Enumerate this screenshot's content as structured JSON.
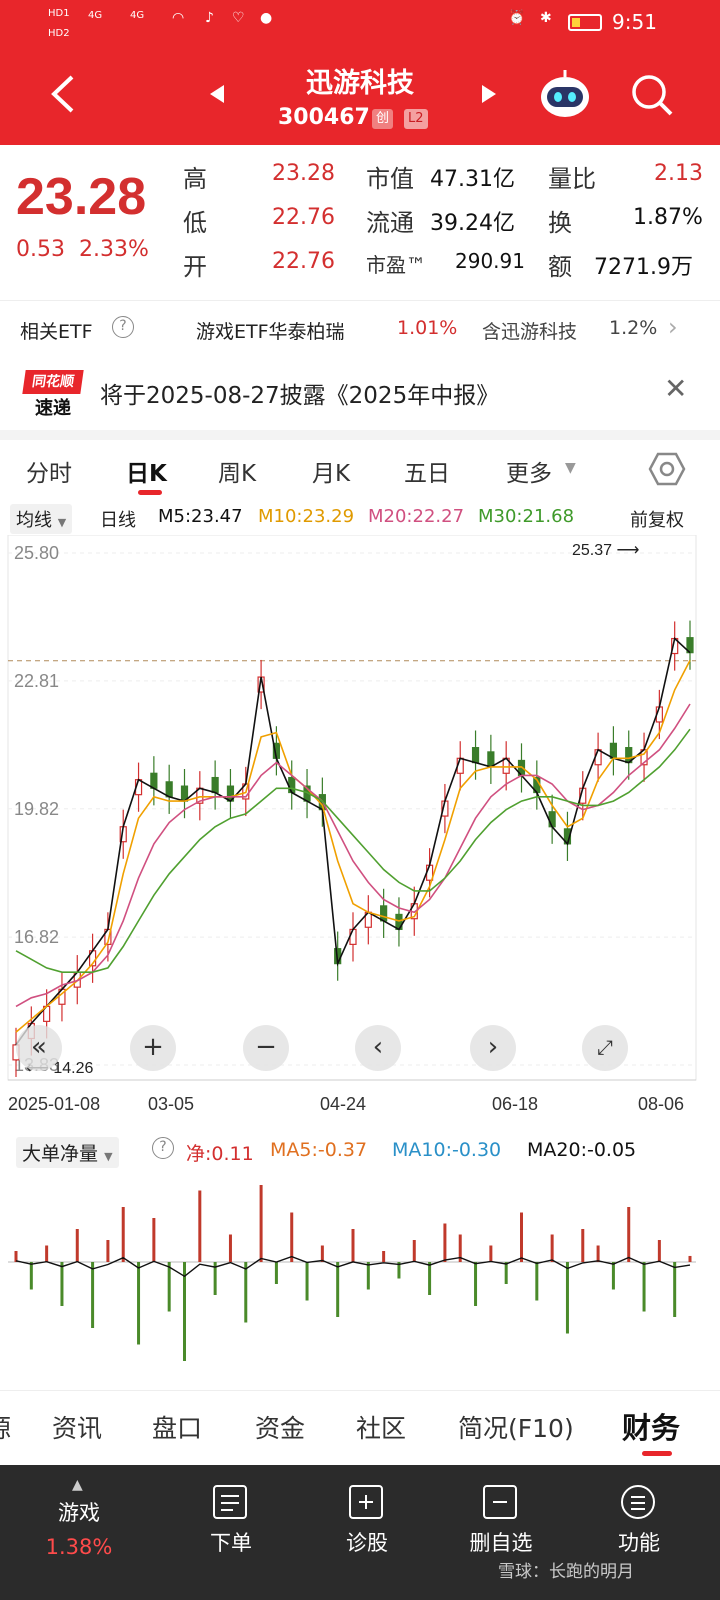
{
  "status_bar": {
    "left": [
      "HD1",
      "HD2",
      "4G",
      "4G"
    ],
    "time": "9:51"
  },
  "header": {
    "title": "迅游科技",
    "code": "300467",
    "tag_chuang": "创",
    "tag_level": "L2"
  },
  "quote": {
    "price": "23.28",
    "change": "0.53",
    "change_pct": "2.33%",
    "high_label": "高",
    "high": "23.28",
    "low_label": "低",
    "low": "22.76",
    "open_label": "开",
    "open": "22.76",
    "mktcap_label": "市值",
    "mktcap": "47.31亿",
    "float_label": "流通",
    "float": "39.24亿",
    "pe_label": "市盈™",
    "pe": "290.91",
    "volratio_label": "量比",
    "volratio": "2.13",
    "turnover_label": "换",
    "turnover": "1.87%",
    "amount_label": "额",
    "amount": "7271.9万"
  },
  "etf": {
    "label": "相关ETF",
    "name": "游戏ETF华泰柏瑞",
    "pct": "1.01%",
    "contains": "含迅游科技",
    "contains_pct": "1.2%"
  },
  "notice": {
    "logo_top": "同花顺",
    "logo_bottom": "速递",
    "text": "将于2025-08-27披露《2025年中报》"
  },
  "ktabs": [
    "分时",
    "日K",
    "周K",
    "月K",
    "五日",
    "更多"
  ],
  "ma_line": {
    "selector": "均线",
    "period": "日线",
    "m5": "M5:23.47",
    "m10": "M10:23.29",
    "m20": "M20:22.27",
    "m30": "M30:21.68",
    "adjust": "前复权"
  },
  "chart_data": {
    "type": "line",
    "x": [
      "2025-01-08",
      "03-05",
      "04-24",
      "06-18",
      "08-06"
    ],
    "ylim": [
      13.83,
      25.8
    ],
    "y_ticks": [
      "25.80",
      "22.81",
      "19.82",
      "16.82",
      "13.83"
    ],
    "max_label": "25.37",
    "min_label": "14.26",
    "series": [
      {
        "name": "M5",
        "color": "#111111",
        "values": [
          14.3,
          14.8,
          15.2,
          15.6,
          16.0,
          16.5,
          17.0,
          19.4,
          20.5,
          20.3,
          20.1,
          20.0,
          20.3,
          20.2,
          20.0,
          20.4,
          22.9,
          21.0,
          20.2,
          20.0,
          19.8,
          16.2,
          17.0,
          17.4,
          17.2,
          17.0,
          17.6,
          18.5,
          20.0,
          21.0,
          20.9,
          20.8,
          21.0,
          20.6,
          20.2,
          19.4,
          19.0,
          20.3,
          21.2,
          21.0,
          20.9,
          21.2,
          22.2,
          23.8,
          23.47
        ]
      },
      {
        "name": "M10",
        "color": "#f0a000",
        "values": [
          14.6,
          14.9,
          15.2,
          15.5,
          15.8,
          16.2,
          16.7,
          18.3,
          19.6,
          20.1,
          20.0,
          20.0,
          20.1,
          20.1,
          20.1,
          20.2,
          21.5,
          21.6,
          20.6,
          20.3,
          19.9,
          18.6,
          17.6,
          17.4,
          17.3,
          17.2,
          17.3,
          18.0,
          19.1,
          20.3,
          20.7,
          20.8,
          20.8,
          20.8,
          20.5,
          19.9,
          19.4,
          19.6,
          20.5,
          21.0,
          21.0,
          21.1,
          21.6,
          22.6,
          23.29
        ]
      },
      {
        "name": "M20",
        "color": "#d05080",
        "values": [
          15.2,
          15.4,
          15.5,
          15.7,
          15.8,
          16.0,
          16.4,
          17.2,
          18.2,
          19.0,
          19.5,
          19.8,
          20.0,
          20.1,
          20.1,
          20.1,
          20.6,
          20.9,
          20.6,
          20.3,
          20.0,
          19.3,
          18.6,
          18.1,
          17.7,
          17.5,
          17.4,
          17.7,
          18.2,
          18.9,
          19.6,
          20.1,
          20.4,
          20.6,
          20.6,
          20.4,
          20.0,
          19.8,
          19.9,
          20.2,
          20.6,
          20.9,
          21.2,
          21.7,
          22.27
        ]
      },
      {
        "name": "M30",
        "color": "#50a030",
        "values": [
          16.5,
          16.3,
          16.1,
          16.0,
          16.0,
          16.0,
          16.1,
          16.6,
          17.2,
          17.8,
          18.3,
          18.7,
          19.1,
          19.4,
          19.6,
          19.7,
          20.0,
          20.3,
          20.3,
          20.2,
          20.0,
          19.6,
          19.2,
          18.8,
          18.4,
          18.1,
          17.9,
          17.9,
          18.2,
          18.6,
          19.1,
          19.5,
          19.8,
          20.0,
          20.1,
          20.1,
          20.0,
          19.9,
          19.9,
          20.0,
          20.2,
          20.5,
          20.8,
          21.2,
          21.68
        ]
      }
    ]
  },
  "sub_indicator": {
    "selector": "大单净量",
    "net": "净:0.11",
    "ma5": "MA5:-0.37",
    "ma10": "MA10:-0.30",
    "ma20": "MA20:-0.05"
  },
  "sub_chart_data": {
    "type": "bar",
    "values": [
      0.2,
      -0.5,
      0.3,
      -0.8,
      0.6,
      -1.2,
      0.4,
      1.0,
      -1.5,
      0.8,
      -0.9,
      -1.8,
      1.3,
      -0.6,
      0.5,
      -1.1,
      1.4,
      -0.4,
      0.9,
      -0.7,
      0.3,
      -1.0,
      0.6,
      -0.5,
      0.2,
      -0.3,
      0.4,
      -0.6,
      0.7,
      0.5,
      -0.8,
      0.3,
      -0.4,
      0.9,
      -0.7,
      0.5,
      -1.3,
      0.6,
      0.3,
      -0.5,
      1.0,
      -0.9,
      0.4,
      -1.0,
      0.11
    ]
  },
  "bottom_tabs": [
    "源",
    "资讯",
    "盘口",
    "资金",
    "社区",
    "简况(F10)",
    "财务"
  ],
  "bottom_nav": {
    "sector": "游戏",
    "sector_pct": "1.38%",
    "items": [
      "下单",
      "诊股",
      "删自选",
      "功能"
    ],
    "watermark": "雪球：长跑的明月"
  }
}
